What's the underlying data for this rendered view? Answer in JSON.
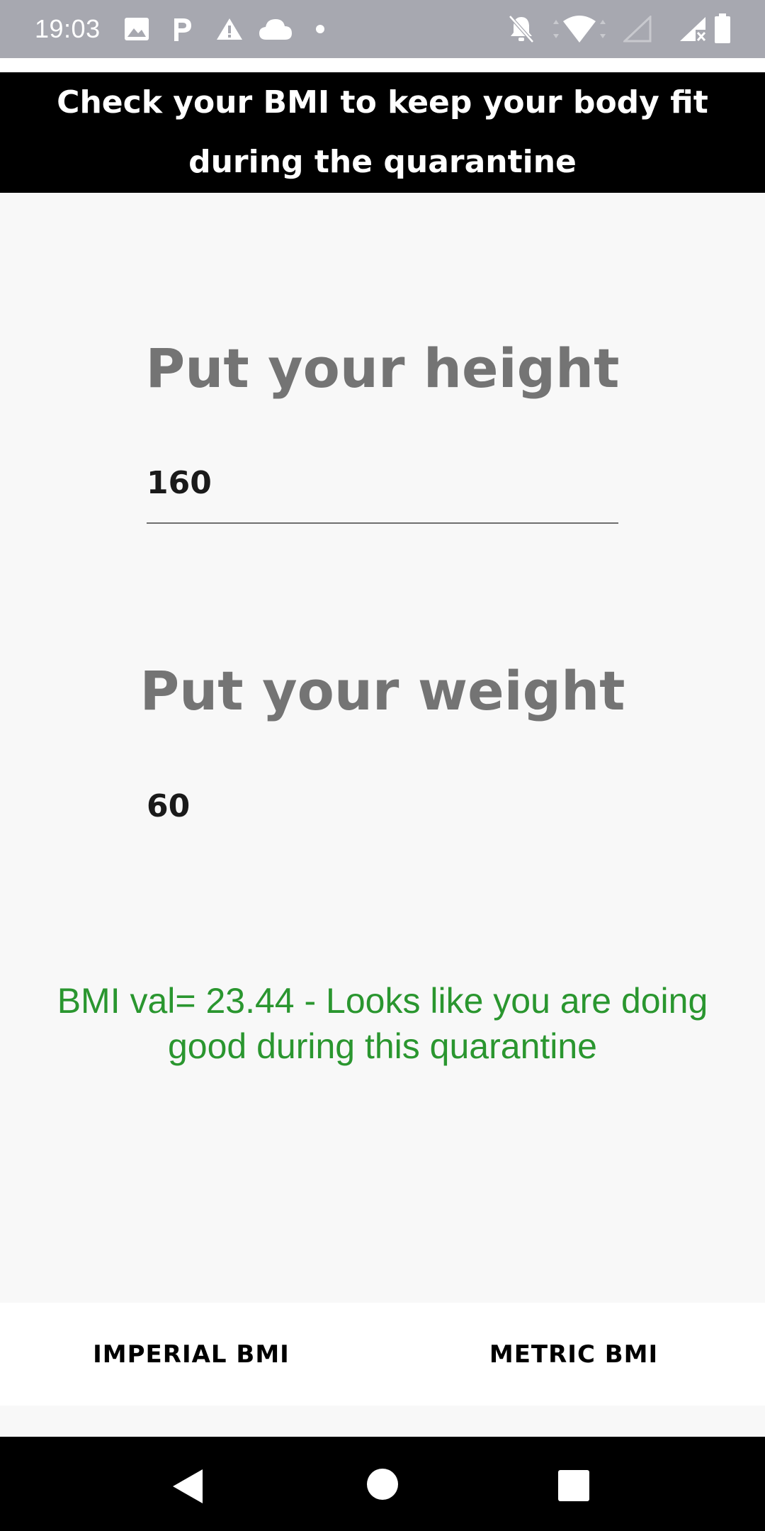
{
  "status_bar": {
    "time": "19:03",
    "icons_left": [
      "image-icon",
      "parking-icon",
      "warning-icon",
      "cloud-icon",
      "dot-icon"
    ],
    "icons_right": [
      "notifications-off-icon",
      "wifi-icon",
      "signal-empty-icon",
      "signal-x-icon",
      "battery-icon"
    ]
  },
  "header": {
    "line1": "Check your BMI to keep your body fit",
    "line2": "during the quarantine"
  },
  "height": {
    "title": "Put your height",
    "value": "160"
  },
  "weight": {
    "title": "Put your weight",
    "value": "60"
  },
  "result": {
    "text": "BMI val= 23.44 - Looks like you are doing good during this quarantine",
    "color": "#2a962f"
  },
  "tabs": {
    "imperial": "IMPERIAL BMI",
    "metric": "METRIC BMI"
  },
  "nav": [
    "back-icon",
    "home-icon",
    "recents-icon"
  ]
}
